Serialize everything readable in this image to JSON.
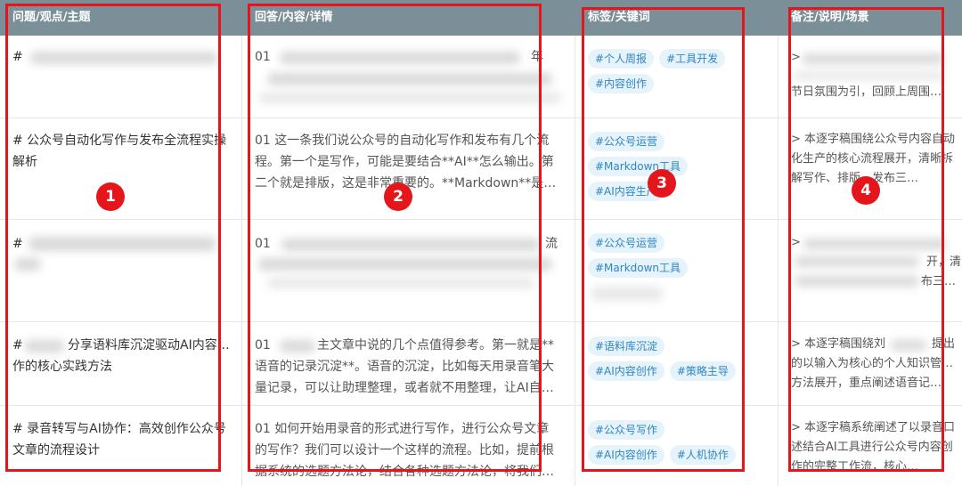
{
  "headers": [
    "问题/观点/主题",
    "回答/内容/详情",
    "标签/关键词",
    "备注/说明/场景"
  ],
  "rows": [
    {
      "topic": "# ",
      "content": "01 ",
      "content2": "年",
      "tags": [
        "#个人周报",
        "#工具开发",
        "#内容创作"
      ],
      "note": "> ",
      "note2": "节日氛围为引，回顾上周围…"
    },
    {
      "topic": "# 公众号自动化写作与发布全流程实操解析",
      "content": "01 这一条我们说公众号的自动化写作和发布有几个流程。第一个是写作，可能是要结合**AI**怎么输出。第二个就是排版，这是非常重要的。**Markdown**是…",
      "tags": [
        "#公众号运营",
        "#Markdown工具",
        "#AI内容生产"
      ],
      "note": "> 本逐字稿围绕公众号内容自动化生产的核心流程展开，清晰拆解写作、排版、发布三…"
    },
    {
      "topic": "# ",
      "content": "01 ",
      "content2": "流",
      "tags": [
        "#公众号运营",
        "#Markdown工具"
      ],
      "note": "> ",
      "note2": "开，清",
      "note3": "布三…"
    },
    {
      "topic": "# ",
      "topic2": "分享语料库沉淀驱动AI内容创作的核心实践方法",
      "content": "01 ",
      "content2": "主文章中说的几个点值得参考。第一就是**语音的记录沉淀**。语音的沉淀，比如每天用录音笔大量记录，可以让助理整理，或者就不用整理，让AI自己…",
      "tags": [
        "#语料库沉淀",
        "#AI内容创作",
        "#策略主导"
      ],
      "note": "> 本逐字稿围绕刘",
      "note2": "提出的以输入为核心的个人知识管理方法展开，重点阐述语音记…"
    },
    {
      "topic": "# 录音转写与AI协作：高效创作公众号文章的流程设计",
      "content": "01 如何开始用录音的形式进行写作，进行公众号文章的写作？我们可以设计一个这样的流程。比如，提前根据系统的选题方法论，结合各种选题方法论，将我们…",
      "tags": [
        "#公众号写作",
        "#AI内容创作",
        "#人机协作"
      ],
      "note": "> 本逐字稿系统阐述了以录音口述结合AI工具进行公众号内容创作的完整工作流，核心…"
    }
  ],
  "annotations": [
    "1",
    "2",
    "3",
    "4"
  ]
}
